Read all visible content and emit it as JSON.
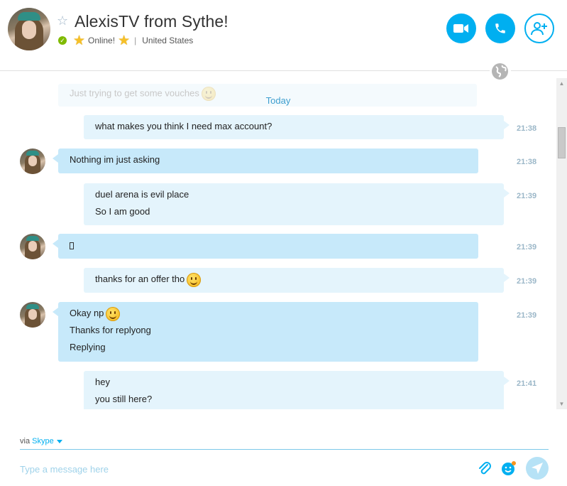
{
  "header": {
    "name": "AlexisTV from Sythe!",
    "status": "Online!",
    "location": "United States",
    "separator": "|"
  },
  "conversation": {
    "faded_message": "Just trying to get some vouches",
    "date_divider": "Today",
    "messages": [
      {
        "direction": "out",
        "lines": [
          "what makes you think I need max account?"
        ],
        "time": "21:38"
      },
      {
        "direction": "in",
        "lines": [
          "Nothing im just asking"
        ],
        "time": "21:38"
      },
      {
        "direction": "out",
        "lines": [
          "duel arena is evil place",
          "So I am good"
        ],
        "time": "21:39"
      },
      {
        "direction": "in",
        "lines": [
          ""
        ],
        "time": "21:39"
      },
      {
        "direction": "out",
        "lines": [
          "thanks for an offer tho"
        ],
        "time": "21:39"
      },
      {
        "direction": "in",
        "lines": [
          "Okay np",
          "Thanks for replyong",
          "Replying"
        ],
        "time": "21:39"
      },
      {
        "direction": "out",
        "lines": [
          "hey",
          "you still here?"
        ],
        "time": "21:41"
      }
    ]
  },
  "composer": {
    "via_label": "via",
    "via_service": "Skype",
    "placeholder": "Type a message here"
  },
  "colors": {
    "accent": "#00aff0",
    "bubble_out": "#e4f4fc",
    "bubble_in": "#c7e9fa",
    "online": "#7fba00"
  },
  "icons": [
    "star-outline-icon",
    "online-check-icon",
    "mood-star-icon",
    "video-call-icon",
    "phone-icon",
    "add-contact-icon",
    "globe-icon",
    "smiley-icon",
    "attach-icon",
    "emoticon-icon",
    "send-icon"
  ]
}
